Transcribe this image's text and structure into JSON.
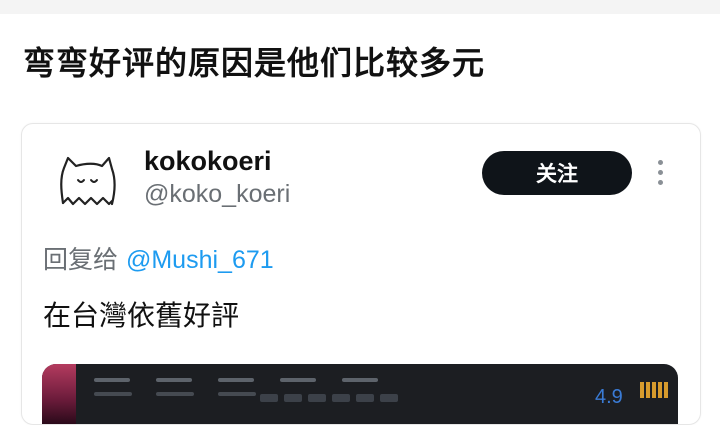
{
  "post": {
    "title": "弯弯好评的原因是他们比较多元"
  },
  "tweet": {
    "display_name": "kokokoeri",
    "handle": "@koko_koeri",
    "follow_label": "关注",
    "reply_prefix": "回复给",
    "reply_mention": "@Mushi_671",
    "text": "在台灣依舊好評"
  },
  "media": {
    "rating": "4.9"
  },
  "icons": {
    "avatar": "ghost-cat-doodle",
    "more": "vertical-dots-icon"
  },
  "colors": {
    "follow_button_bg": "#0f1419",
    "mention_blue": "#1d9bf0",
    "muted_text": "#6a6f74"
  }
}
